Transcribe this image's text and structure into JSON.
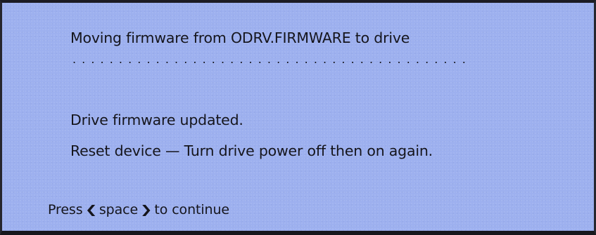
{
  "dialog": {
    "status": "Moving firmware from ODRV.FIRMWARE to drive",
    "progress_dots": "...........................................",
    "result": "Drive firmware updated.",
    "instruction": "Reset device — Turn drive power off then on again.",
    "prompt": {
      "prefix": "Press",
      "key_open": "❮",
      "key": "space",
      "key_close": "❯",
      "suffix": "to continue"
    }
  },
  "colors": {
    "screen_background": "#9db0ef",
    "text": "#15151c",
    "frame": "#1c1c24"
  }
}
